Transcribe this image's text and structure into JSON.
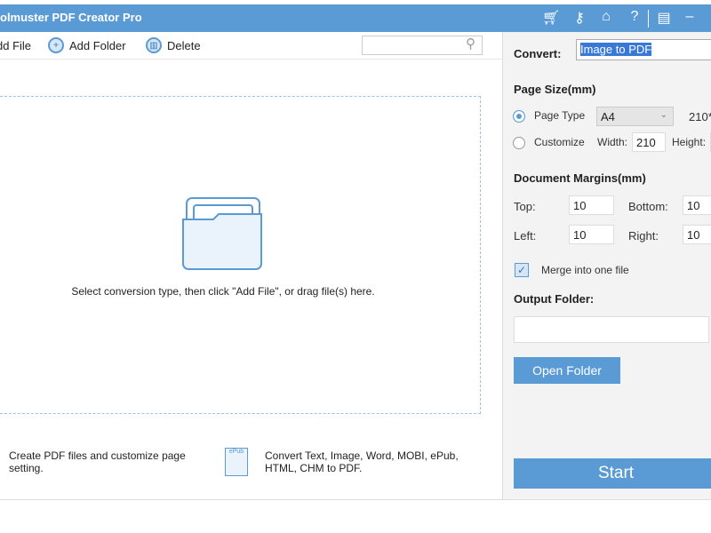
{
  "title": "olmuster PDF Creator Pro",
  "title_icons": [
    "cart-icon",
    "key-icon",
    "home-icon",
    "help-icon",
    "feedback-icon",
    "minimize-icon"
  ],
  "toolbar": {
    "add_file": "dd File",
    "add_folder": "Add Folder",
    "delete": "Delete",
    "search_placeholder": ""
  },
  "drop": {
    "hint": "Select conversion type, then click \"Add File\", or drag file(s) here."
  },
  "features": [
    {
      "text": "Create PDF files and customize page setting."
    },
    {
      "text": "Convert Text, Image, Word, MOBI, ePub, HTML, CHM to PDF.",
      "icon_label": "ePub"
    }
  ],
  "panel": {
    "convert_label": "Convert:",
    "convert_value": "Image to PDF",
    "page_size_title": "Page Size(mm)",
    "page_type_label": "Page Type",
    "page_type_value": "A4",
    "page_dims": "210*",
    "customize_label": "Customize",
    "width_label": "Width:",
    "width_value": "210",
    "height_label": "Height:",
    "margins_title": "Document Margins(mm)",
    "top_label": "Top:",
    "top_value": "10",
    "bottom_label": "Bottom:",
    "bottom_value": "10",
    "left_label": "Left:",
    "left_value": "10",
    "right_label": "Right:",
    "right_value": "10",
    "merge_label": "Merge into one file",
    "merge_checked": true,
    "output_title": "Output Folder:",
    "output_value": "",
    "open_folder": "Open Folder",
    "start": "Start"
  },
  "colors": {
    "accent": "#5b9bd5"
  }
}
